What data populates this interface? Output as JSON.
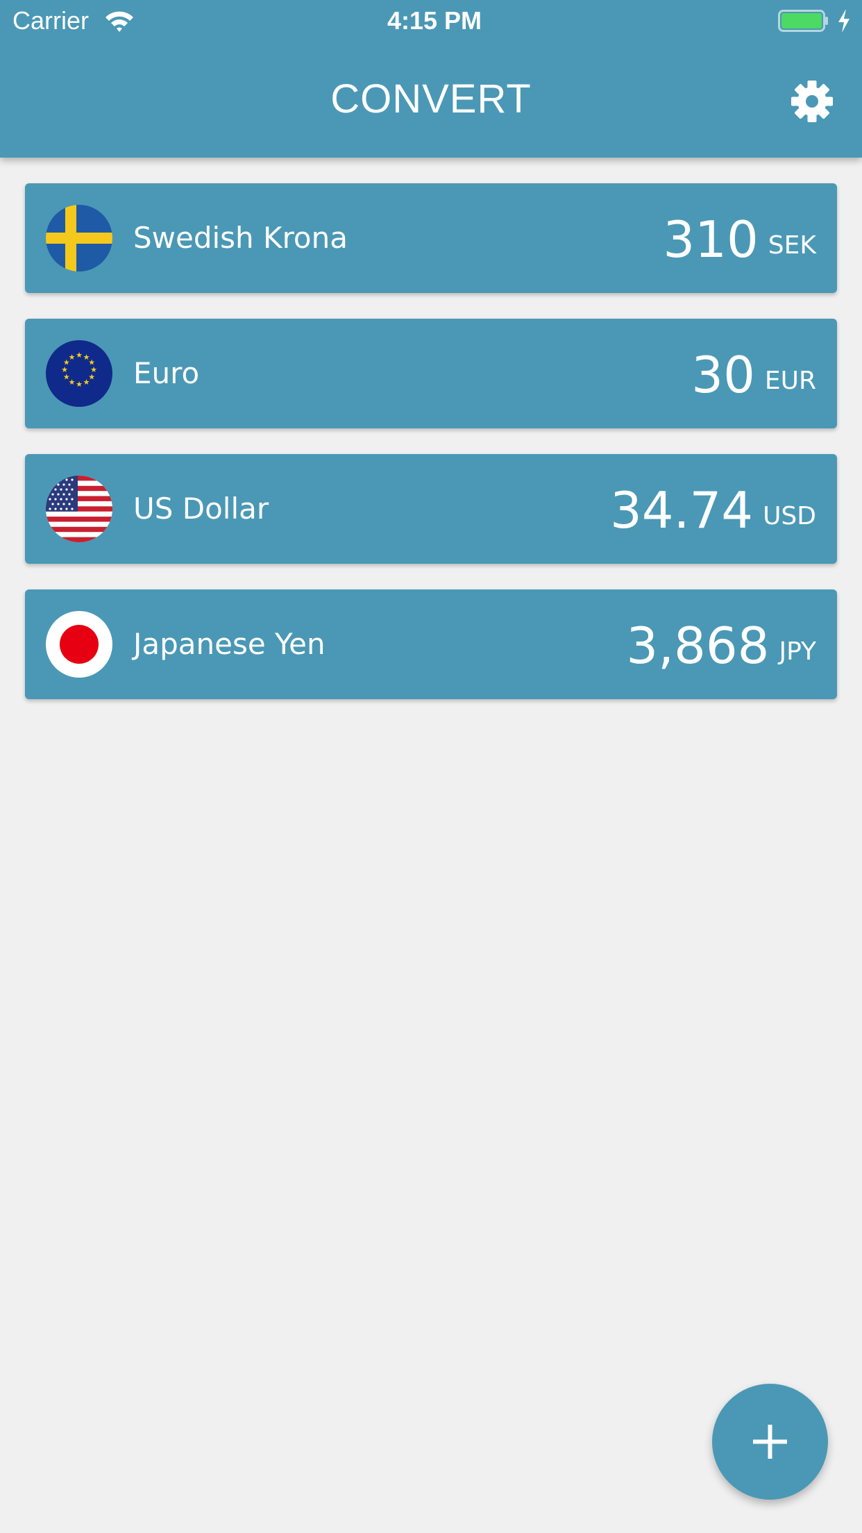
{
  "status_bar": {
    "carrier": "Carrier",
    "time": "4:15 PM",
    "icons": [
      "wifi-icon",
      "battery-icon",
      "charging-bolt-icon"
    ]
  },
  "header": {
    "title": "CONVERT",
    "settings_icon": "gear-icon"
  },
  "currencies": [
    {
      "name": "Swedish Krona",
      "amount": "310",
      "code": "SEK",
      "flag": "sweden-flag-icon"
    },
    {
      "name": "Euro",
      "amount": "30",
      "code": "EUR",
      "flag": "eu-flag-icon"
    },
    {
      "name": "US Dollar",
      "amount": "34.74",
      "code": "USD",
      "flag": "us-flag-icon"
    },
    {
      "name": "Japanese Yen",
      "amount": "3,868",
      "code": "JPY",
      "flag": "japan-flag-icon"
    }
  ],
  "add_button": {
    "icon": "plus-icon"
  },
  "colors": {
    "primary": "#4a98b5",
    "background": "#f0f0f1",
    "text_on_primary": "#ffffff",
    "battery": "#4cd964"
  }
}
